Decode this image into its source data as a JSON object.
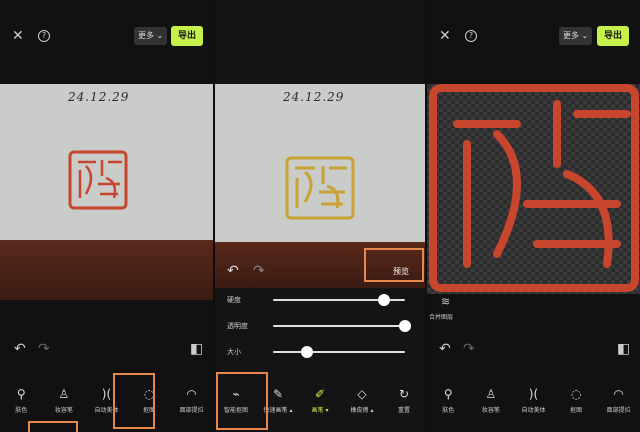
{
  "date_text": "24.12.29",
  "icons": {
    "close": "close-icon",
    "help": "help-icon",
    "undo": "undo-icon",
    "redo": "redo-icon",
    "compare": "compare-icon",
    "chevron": "chevron-down-icon"
  },
  "header": {
    "more_label": "更多",
    "export_label": "导出"
  },
  "panel1": {
    "tools": [
      {
        "label": "肤色"
      },
      {
        "label": "妆容笔"
      },
      {
        "label": "自动美体"
      },
      {
        "label": "抠图"
      },
      {
        "label": "面部提拉"
      },
      {
        "label": "更"
      }
    ]
  },
  "panel2": {
    "preview_label": "预览",
    "sliders": [
      {
        "label": "硬度",
        "value": 0.84
      },
      {
        "label": "透明度",
        "value": 1.0
      },
      {
        "label": "大小",
        "value": 0.26
      }
    ],
    "tools": [
      {
        "label": "智能抠图"
      },
      {
        "label": "快速画笔 ▴"
      },
      {
        "label": "画笔 ▾"
      },
      {
        "label": "橡皮擦 ▴"
      },
      {
        "label": "重置"
      }
    ]
  },
  "panel3": {
    "merge_label": "合并图层",
    "tools": [
      {
        "label": "肤色"
      },
      {
        "label": "妆容笔"
      },
      {
        "label": "自动美体"
      },
      {
        "label": "抠图"
      },
      {
        "label": "面部提拉"
      }
    ]
  },
  "colors": {
    "accent": "#c6f04b",
    "highlight_box": "#e8874a",
    "seal_red": "#c8452e",
    "seal_gold": "#c9a235"
  }
}
